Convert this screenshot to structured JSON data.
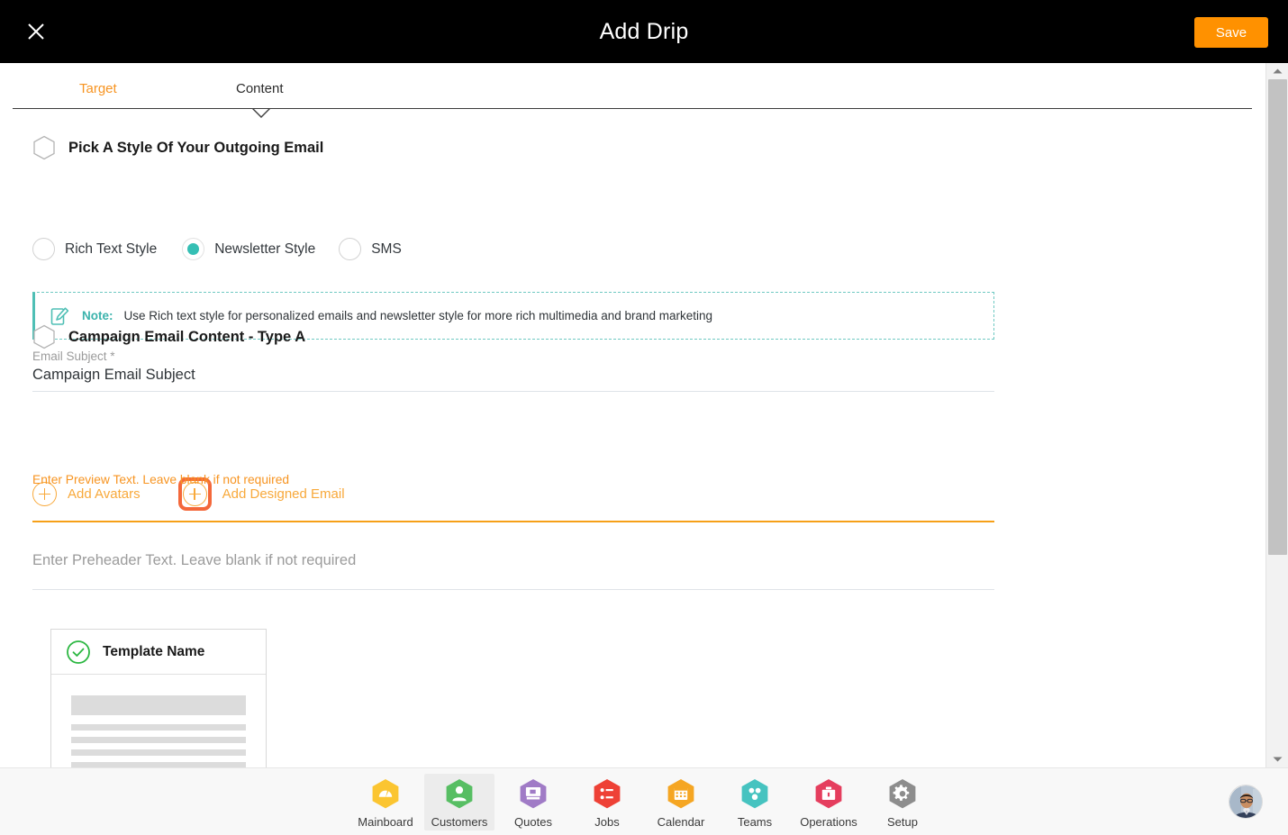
{
  "topbar": {
    "title": "Add Drip",
    "close_icon": "close-icon",
    "save_label": "Save"
  },
  "tabs": [
    {
      "label": "Target",
      "state": "completed"
    },
    {
      "label": "Content",
      "state": "active"
    }
  ],
  "sections": {
    "style": {
      "heading": "Pick A Style Of Your Outgoing Email",
      "marker_icon": "hexagon-outline-icon",
      "options": [
        {
          "label": "Rich Text Style",
          "selected": false
        },
        {
          "label": "Newsletter Style",
          "selected": true
        },
        {
          "label": "SMS",
          "selected": false
        }
      ],
      "note": {
        "icon": "edit-note-icon",
        "label": "Note:",
        "text": "Use Rich text style for personalized emails and newsletter style for more rich multimedia and brand marketing"
      }
    },
    "campaign": {
      "heading": "Campaign Email Content - Type A",
      "marker_icon": "hexagon-outline-icon",
      "subject_field": {
        "label": "Email Subject *",
        "value": "Campaign Email Subject"
      },
      "actions": [
        {
          "label": "Add Avatars",
          "icon": "plus-circle-icon",
          "highlighted": false
        },
        {
          "label": "Add Designed Email",
          "icon": "plus-circle-icon",
          "highlighted": true
        }
      ],
      "preview_field": {
        "label": "Enter Preview Text. Leave blank if not required",
        "value": "",
        "focused": true
      },
      "preheader_field": {
        "placeholder": "Enter Preheader Text. Leave blank if not required",
        "value": "",
        "focused": false
      },
      "template_card": {
        "name": "Template Name",
        "status_icon": "check-circle-icon",
        "selected": true
      }
    }
  },
  "scrollbar": {
    "up_icon": "chevron-up-icon",
    "down_icon": "chevron-down-icon"
  },
  "bottom_nav": {
    "items": [
      {
        "label": "Mainboard",
        "icon": "dashboard-hex-icon",
        "color": "#FBC531",
        "active": false
      },
      {
        "label": "Customers",
        "icon": "person-hex-icon",
        "color": "#57BE63",
        "active": true
      },
      {
        "label": "Quotes",
        "icon": "documents-hex-icon",
        "color": "#A07BC6",
        "active": false
      },
      {
        "label": "Jobs",
        "icon": "checklist-hex-icon",
        "color": "#EE4136",
        "active": false
      },
      {
        "label": "Calendar",
        "icon": "calendar-hex-icon",
        "color": "#F5A623",
        "active": false
      },
      {
        "label": "Teams",
        "icon": "teams-hex-icon",
        "color": "#46C3C0",
        "active": false
      },
      {
        "label": "Operations",
        "icon": "briefcase-hex-icon",
        "color": "#E53E5E",
        "active": false
      },
      {
        "label": "Setup",
        "icon": "gear-hex-icon",
        "color": "#8D8D8D",
        "active": false
      }
    ],
    "avatar": "user-avatar"
  },
  "colors": {
    "accent_orange": "#F79421",
    "save_orange": "#FF9100",
    "teal": "#35bfb4",
    "highlight_ring": "#F4683A",
    "topbar_bg": "#000000"
  }
}
